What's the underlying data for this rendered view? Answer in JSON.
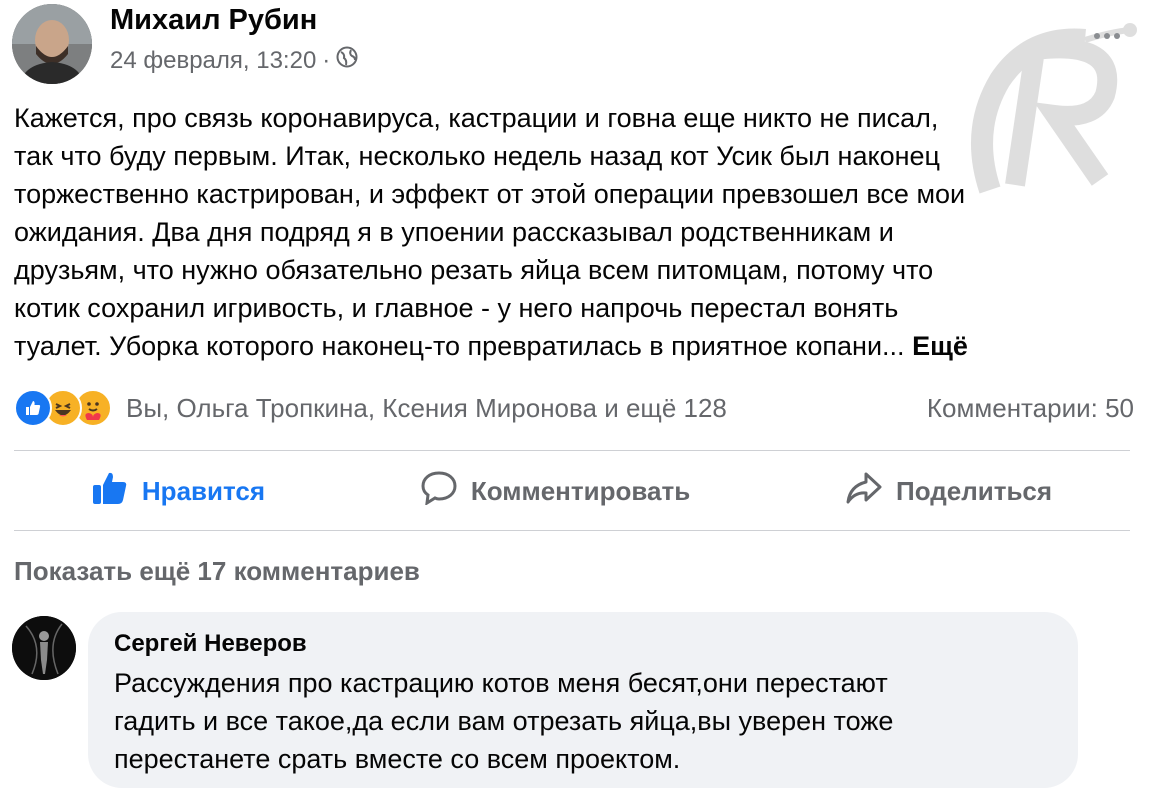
{
  "post": {
    "author": "Михаил Рубин",
    "date": "24 февраля, 13:20",
    "separator": "·",
    "audience_icon": "globe-icon",
    "text": "Кажется, про связь коронавируса, кастрации и говна еще никто не писал,\nтак что буду первым. Итак, несколько недель назад кот Усик был наконец\nторжественно кастрирован, и эффект от этой операции превзошел все мои\nожидания. Два дня подряд я в упоении рассказывал родственникам и\nдрузьям, что нужно обязательно резать яйца всем питомцам, потому что\nкотик сохранил игривость, и главное - у него напрочь перестал вонять\nтуалет. Уборка которого наконец-то превратилась в приятное копани...",
    "see_more": "Ещё"
  },
  "reactions": {
    "icons": [
      "like-reaction-icon",
      "haha-reaction-icon",
      "care-reaction-icon"
    ],
    "names": "Вы, Ольга Тропкина, Ксения Миронова и ещё 128",
    "comments_count": "Комментарии: 50"
  },
  "actions": {
    "like": "Нравится",
    "comment": "Комментировать",
    "share": "Поделиться"
  },
  "show_more_comments": "Показать ещё 17 комментариев",
  "comment": {
    "author": "Сергей Неверов",
    "text": "Рассуждения про кастрацию котов меня бесят,они перестают\nгадить и все такое,да если вам отрезать яйца,вы уверен тоже\nперестанете срать вместе со всем проектом."
  },
  "colors": {
    "accent": "#1877f2",
    "secondary_text": "#65676b",
    "bubble": "#f0f2f5",
    "haha": "#f7b125",
    "care": "#f7b125"
  }
}
